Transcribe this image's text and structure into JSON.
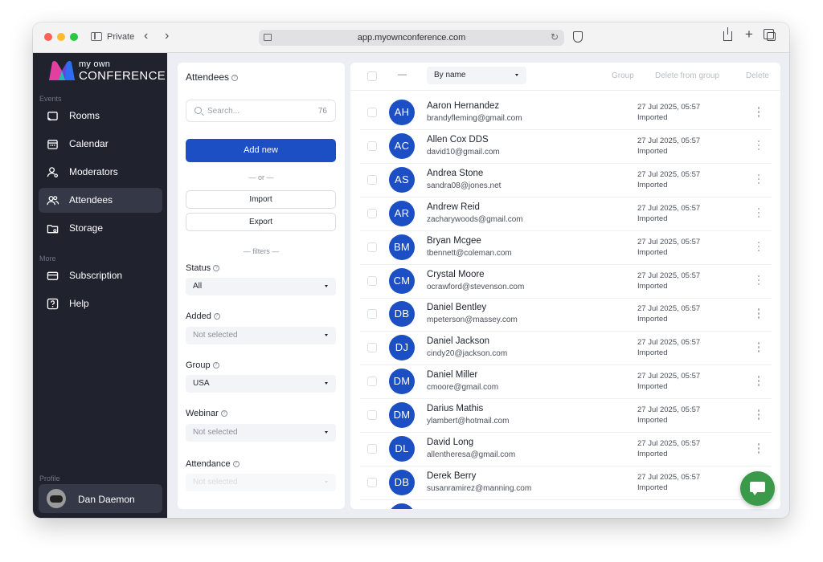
{
  "browser": {
    "mode_label": "Private",
    "url": "app.myownconference.com"
  },
  "brand": {
    "line1": "my own",
    "line2": "CONFERENCE",
    "colors": {
      "pink": "#e23fa0",
      "purple": "#6b45d8",
      "blue": "#2a6ff2",
      "teal": "#20c0b0"
    }
  },
  "sidebar": {
    "events_label": "Events",
    "more_label": "More",
    "profile_label": "Profile",
    "events_items": [
      {
        "label": "Rooms",
        "icon": "cast-icon"
      },
      {
        "label": "Calendar",
        "icon": "calendar-icon"
      },
      {
        "label": "Moderators",
        "icon": "user-gear-icon"
      },
      {
        "label": "Attendees",
        "icon": "users-icon",
        "active": true
      },
      {
        "label": "Storage",
        "icon": "folder-icon"
      }
    ],
    "more_items": [
      {
        "label": "Subscription",
        "icon": "card-icon"
      },
      {
        "label": "Help",
        "icon": "question-icon"
      }
    ],
    "profile": {
      "name": "Dan Daemon"
    }
  },
  "filters": {
    "title": "Attendees",
    "search_placeholder": "Search...",
    "count": "76",
    "add_new": "Add new",
    "or_text": "— or —",
    "import": "Import",
    "export": "Export",
    "filters_heading": "— filters —",
    "fields": [
      {
        "label": "Status",
        "value": "All",
        "muted": false
      },
      {
        "label": "Added",
        "value": "Not selected",
        "muted": true
      },
      {
        "label": "Group",
        "value": "USA",
        "muted": false
      },
      {
        "label": "Webinar",
        "value": "Not selected",
        "muted": true
      },
      {
        "label": "Attendance",
        "value": "Not selected",
        "muted": true
      }
    ]
  },
  "list": {
    "dash": "—",
    "sort_value": "By name",
    "actions": {
      "group": "Group",
      "delete_from_group": "Delete from group",
      "delete": "Delete"
    },
    "accent_color": "#1c4fc4",
    "rows": [
      {
        "initials": "AH",
        "name": "Aaron Hernandez",
        "email": "brandyfleming@gmail.com",
        "date": "27 Jul 2025, 05:57",
        "source": "Imported"
      },
      {
        "initials": "AC",
        "name": "Allen Cox DDS",
        "email": "david10@gmail.com",
        "date": "27 Jul 2025, 05:57",
        "source": "Imported"
      },
      {
        "initials": "AS",
        "name": "Andrea Stone",
        "email": "sandra08@jones.net",
        "date": "27 Jul 2025, 05:57",
        "source": "Imported"
      },
      {
        "initials": "AR",
        "name": "Andrew Reid",
        "email": "zacharywoods@gmail.com",
        "date": "27 Jul 2025, 05:57",
        "source": "Imported"
      },
      {
        "initials": "BM",
        "name": "Bryan Mcgee",
        "email": "tbennett@coleman.com",
        "date": "27 Jul 2025, 05:57",
        "source": "Imported"
      },
      {
        "initials": "CM",
        "name": "Crystal Moore",
        "email": "ocrawford@stevenson.com",
        "date": "27 Jul 2025, 05:57",
        "source": "Imported"
      },
      {
        "initials": "DB",
        "name": "Daniel Bentley",
        "email": "mpeterson@massey.com",
        "date": "27 Jul 2025, 05:57",
        "source": "Imported"
      },
      {
        "initials": "DJ",
        "name": "Daniel Jackson",
        "email": "cindy20@jackson.com",
        "date": "27 Jul 2025, 05:57",
        "source": "Imported"
      },
      {
        "initials": "DM",
        "name": "Daniel Miller",
        "email": "cmoore@gmail.com",
        "date": "27 Jul 2025, 05:57",
        "source": "Imported"
      },
      {
        "initials": "DM",
        "name": "Darius Mathis",
        "email": "ylambert@hotmail.com",
        "date": "27 Jul 2025, 05:57",
        "source": "Imported"
      },
      {
        "initials": "DL",
        "name": "David Long",
        "email": "allentheresa@gmail.com",
        "date": "27 Jul 2025, 05:57",
        "source": "Imported"
      },
      {
        "initials": "DB",
        "name": "Derek Berry",
        "email": "susanramirez@manning.com",
        "date": "27 Jul 2025, 05:57",
        "source": "Imported"
      }
    ]
  }
}
